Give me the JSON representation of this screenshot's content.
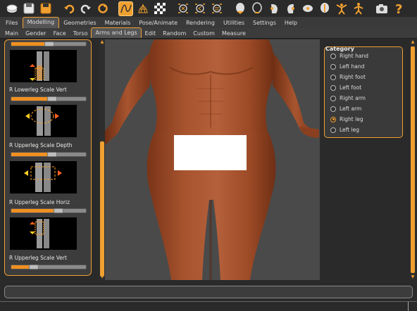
{
  "toolbar": {
    "buttons": [
      {
        "icon": "undo-icon"
      },
      {
        "icon": "redo-icon"
      }
    ]
  },
  "menu": {
    "tabs": [
      "Files",
      "Modelling",
      "Geometries",
      "Materials",
      "Pose/Animate",
      "Rendering",
      "Utilities",
      "Settings",
      "Help"
    ],
    "active": "Modelling"
  },
  "subtabs": {
    "tabs": [
      "Main",
      "Gender",
      "Face",
      "Torso",
      "Arms and Legs",
      "Edit",
      "Random",
      "Custom",
      "Measure"
    ],
    "active": "Arms and Legs"
  },
  "left_panel": {
    "items": [
      {
        "label": "R Lowerleg Scale Vert",
        "value": 0.5
      },
      {
        "label": "R Upperleg Scale Depth",
        "value": 0.5
      },
      {
        "label": "R Upperleg Scale Horiz",
        "value": 0.6
      },
      {
        "label": "R Upperleg Scale Vert",
        "value": 0.25
      }
    ],
    "top_slider_value": 0.45
  },
  "category": {
    "title": "Category",
    "options": [
      "Right hand",
      "Left hand",
      "Right foot",
      "Left foot",
      "Right arm",
      "Left arm",
      "Right leg",
      "Left leg"
    ],
    "selected": "Right leg"
  },
  "colors": {
    "accent": "#f0a030",
    "background": "#2a2a2a",
    "panel": "#3c3c3c",
    "skin": "#a8552f"
  }
}
